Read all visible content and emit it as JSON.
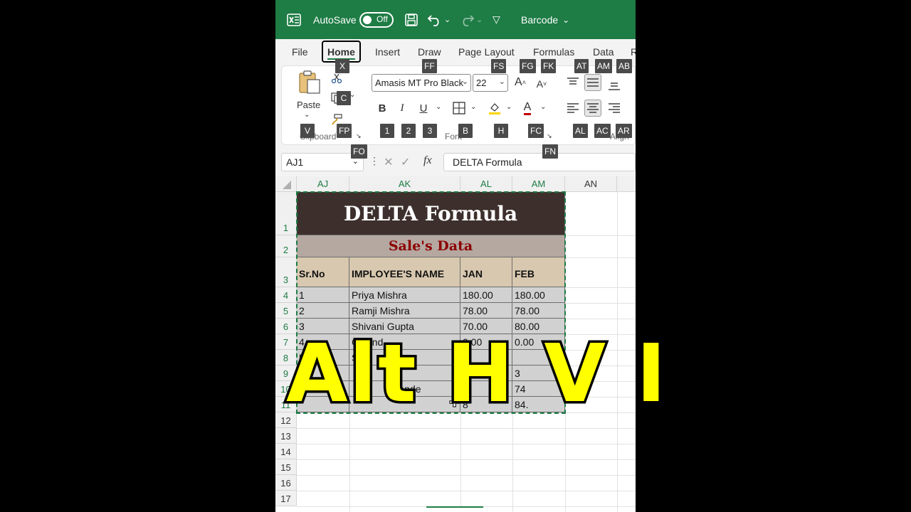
{
  "titlebar": {
    "autosave_label": "AutoSave",
    "autosave_state": "Off",
    "filename": "Barcode",
    "accent": "#1e7c45"
  },
  "tabs": [
    {
      "label": "File"
    },
    {
      "label": "Home"
    },
    {
      "label": "Insert"
    },
    {
      "label": "Draw"
    },
    {
      "label": "Page Layout"
    },
    {
      "label": "Formulas"
    },
    {
      "label": "Data"
    },
    {
      "label": "R"
    }
  ],
  "ribbon": {
    "paste_label": "Paste",
    "clipboard_group": "Clipboard",
    "font_group": "Font",
    "alignment_group": "Align",
    "font_name": "Amasis MT Pro Black",
    "font_size": "22",
    "bold": "B",
    "italic": "I",
    "underline": "U"
  },
  "keytips": {
    "home": "X",
    "draw": "FF",
    "layout": "FS",
    "formulas_g": "FG",
    "formulas_k": "FK",
    "at": "AT",
    "am": "AM",
    "ab": "AB",
    "copy": "C",
    "paste": "V",
    "fp": "FP",
    "fo": "FO",
    "b": "1",
    "i": "2",
    "u": "3",
    "border": "B",
    "fill": "H",
    "fc": "FC",
    "fn": "FN",
    "al": "AL",
    "ac": "AC",
    "ar": "AR"
  },
  "formula_bar": {
    "name_box": "AJ1",
    "content": "DELTA Formula"
  },
  "columns": [
    "AJ",
    "AK",
    "AL",
    "AM",
    "AN"
  ],
  "rows": [
    "1",
    "2",
    "3",
    "4",
    "5",
    "6",
    "7",
    "8",
    "9",
    "10",
    "11",
    "12",
    "13",
    "14",
    "15",
    "16",
    "17"
  ],
  "sheet": {
    "title": "DELTA Formula",
    "subtitle": "Sale's Data",
    "headers": [
      "Sr.No",
      "IMPLOYEE'S NAME",
      "JAN",
      "FEB"
    ],
    "data": [
      [
        "1",
        "Priya Mishra",
        "180.00",
        "180.00"
      ],
      [
        "2",
        "Ramji Mishra",
        "78.00",
        "78.00"
      ],
      [
        "3",
        "Shivani Gupta",
        "70.00",
        "80.00"
      ],
      [
        "4",
        "Govind",
        "0.00",
        "0.00"
      ],
      [
        "5",
        "S",
        "1",
        ""
      ],
      [
        "",
        "A",
        "",
        "3"
      ],
      [
        "",
        "Pande",
        "7",
        "74"
      ],
      [
        "",
        "",
        "8",
        "84."
      ]
    ]
  },
  "overlay_text": "Alt H V I",
  "colors": {
    "title_bg": "#3d302c",
    "subtitle_bg": "#b5a8a1",
    "subtitle_text": "#8b0000",
    "header_bg": "#d8c8af",
    "data_bg": "#d1d1d1",
    "overlay": "#ffff00"
  }
}
